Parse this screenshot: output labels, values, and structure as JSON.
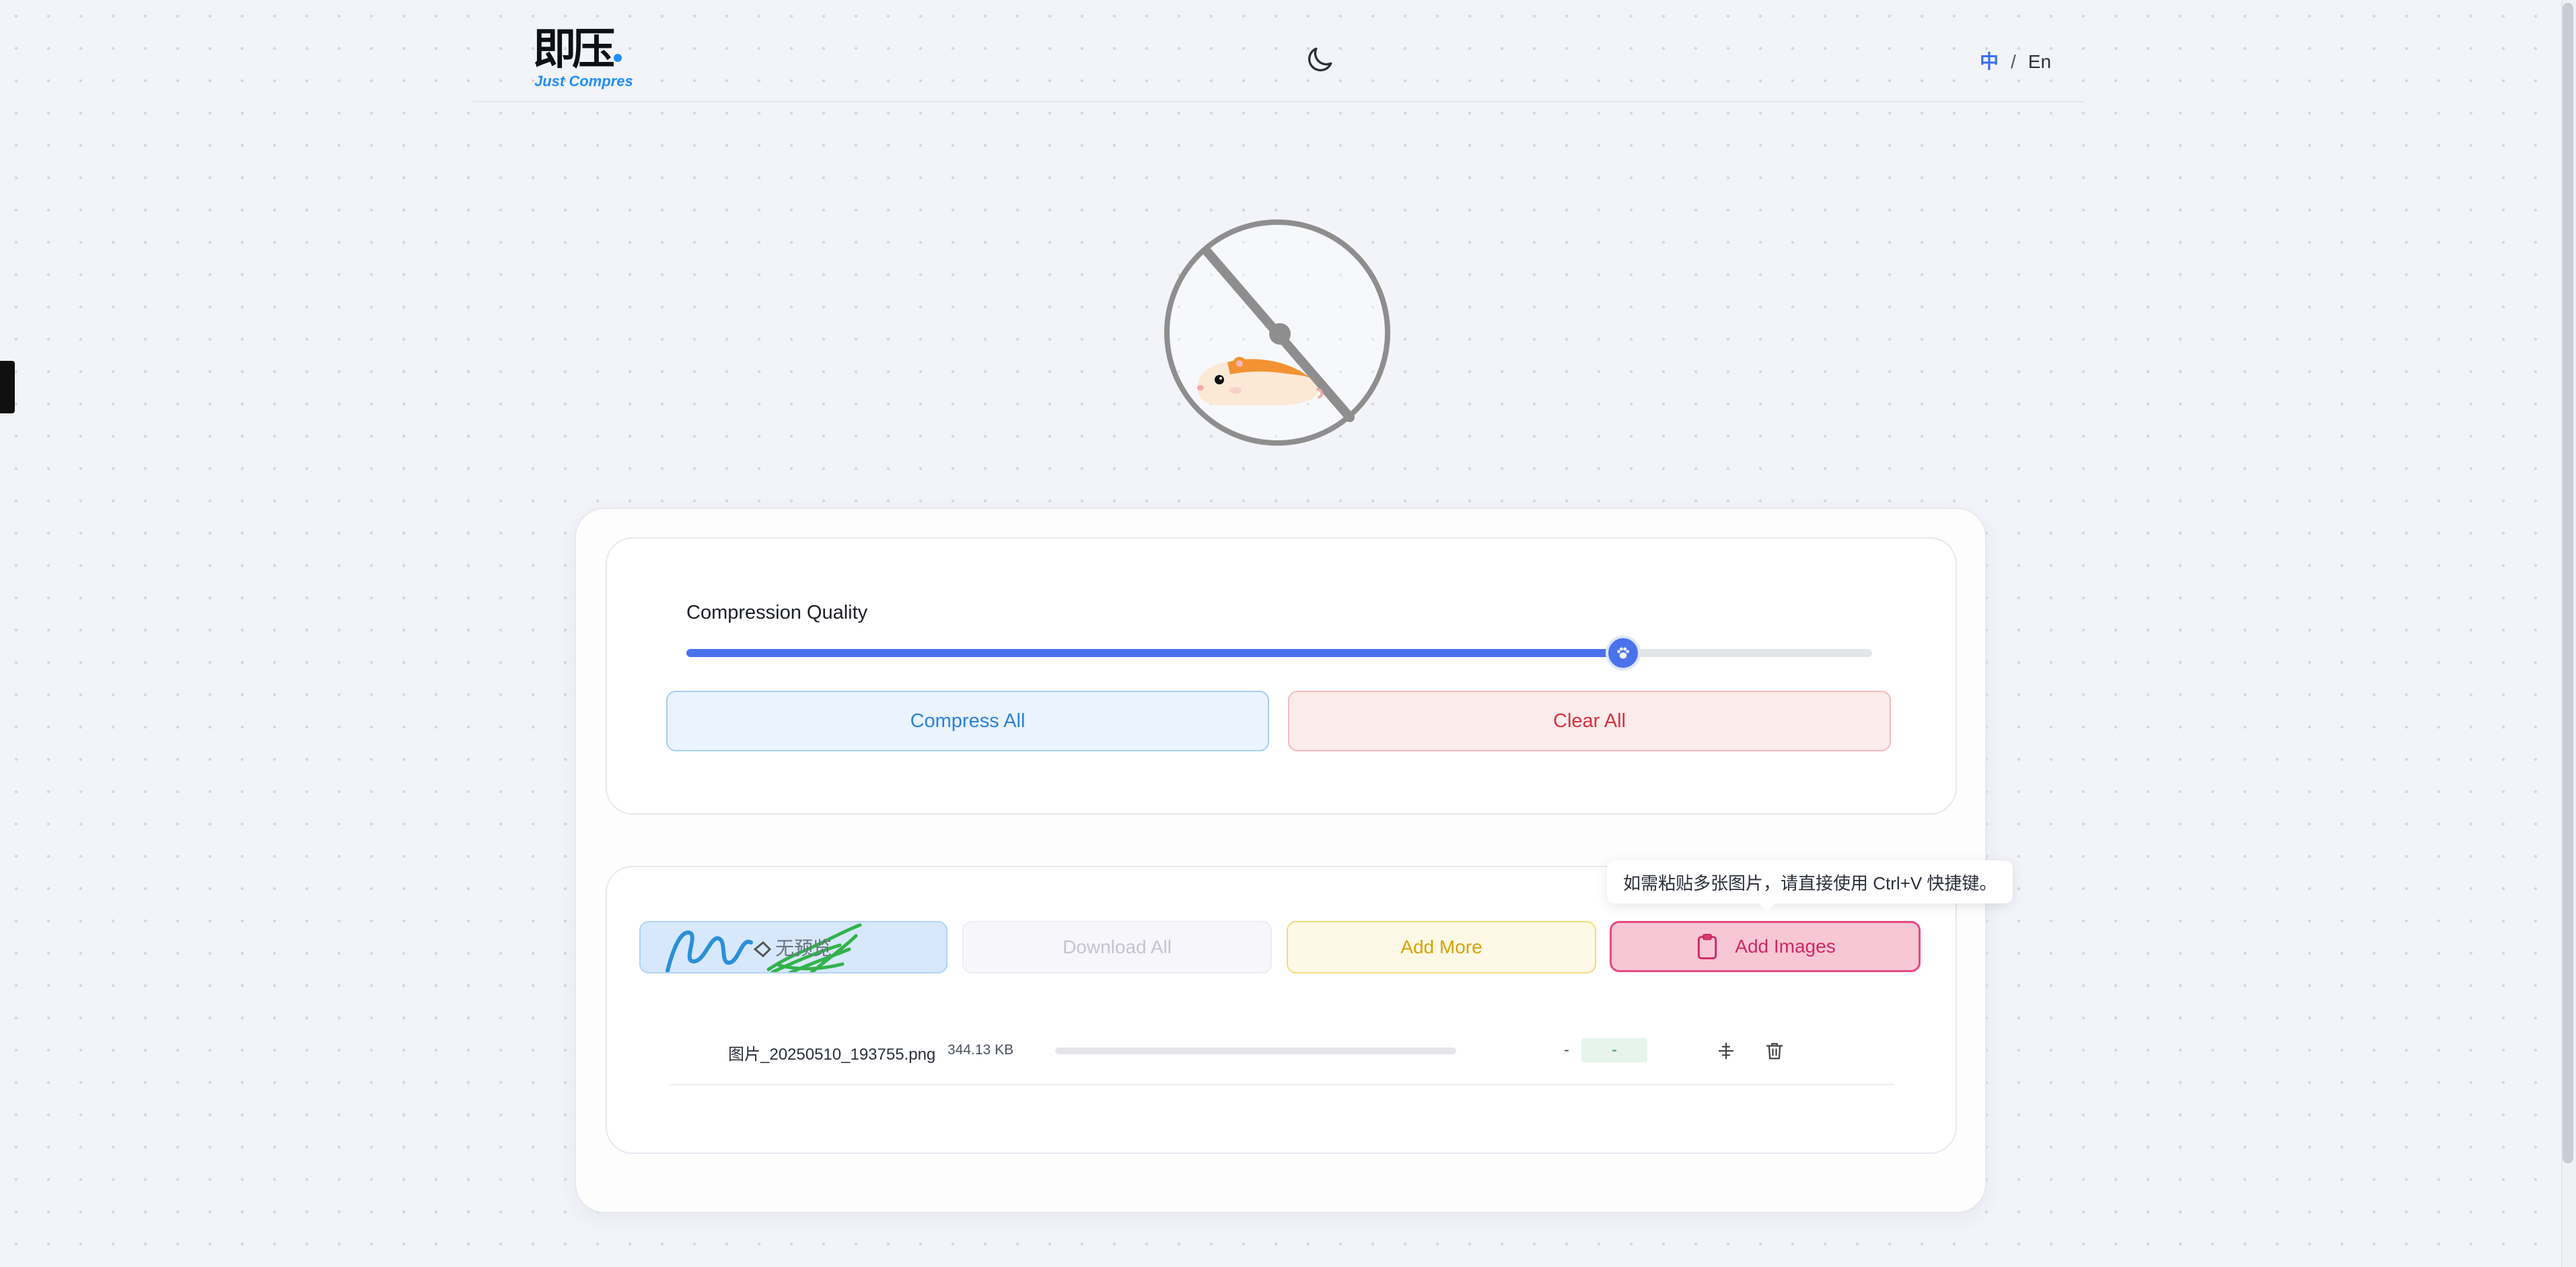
{
  "header": {
    "logo_mark": "即压",
    "logo_subtitle": "Just Compres",
    "theme_toggle_icon": "moon-icon",
    "lang_zh": "中",
    "lang_separator": "/",
    "lang_en": "En"
  },
  "mascot": {
    "icon": "hamster-wheel-illustration"
  },
  "settings": {
    "quality_label": "Compression Quality",
    "quality_fraction": 0.79,
    "slider_thumb_icon": "paw-icon",
    "compress_all": "Compress All",
    "clear_all": "Clear All"
  },
  "actions": {
    "no_preview": "无预览",
    "download_all": "Download All",
    "add_more": "Add More",
    "add_images": "Add Images",
    "add_images_icon": "clipboard-icon",
    "tooltip": "如需粘贴多张图片，请直接使用 Ctrl+V 快捷键。"
  },
  "files": [
    {
      "name": "图片_20250510_193755.png",
      "size": "344.13 KB",
      "progress": 0,
      "compressed_size": "-",
      "ratio": "-",
      "compare_icon": "compare-icon",
      "delete_icon": "trash-icon"
    }
  ],
  "colors": {
    "accent_blue": "#4a72ec",
    "compress_blue": "#2a82d6",
    "clear_red": "#d8303d",
    "add_more_yellow": "#d6a300",
    "add_images_pink": "#e64981",
    "logo_blue": "#1e8ffa"
  }
}
